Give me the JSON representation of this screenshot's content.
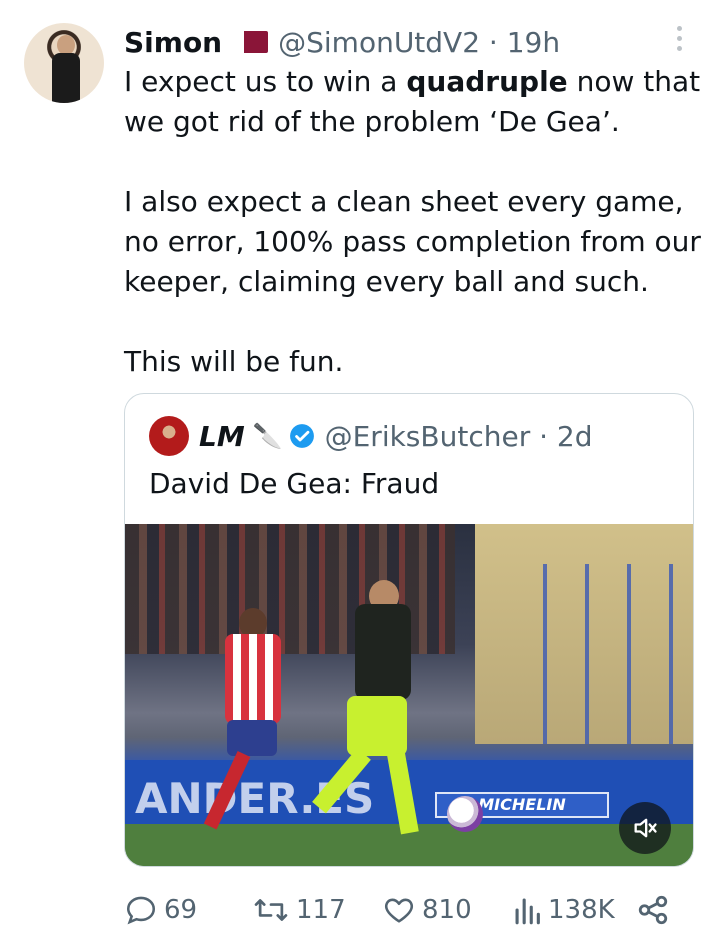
{
  "post": {
    "author": {
      "name": "Simon",
      "handle": "@SimonUtdV2",
      "time": "19h"
    },
    "text_lines": [
      "I expect us to win a ",
      "quadruple",
      " now that we got rid of the problem ‘De Gea’.\n\nI also expect a clean sheet every game, no error, 100% pass completion from our keeper, claiming every ball and such.\n\nThis will be fun."
    ]
  },
  "quoted": {
    "author": {
      "name": "LM",
      "handle": "@EriksButcher",
      "time": "2d"
    },
    "text": "David De Gea: Fraud",
    "media": {
      "board_text_left": "ANDER.ES",
      "board_text_right": "MICHELIN"
    }
  },
  "actions": {
    "replies": "69",
    "reposts": "117",
    "likes": "810",
    "views": "138K"
  },
  "colors": {
    "muted": "#536471",
    "verified": "#1d9bf0"
  },
  "icons": {
    "reply": "reply-icon",
    "repost": "repost-icon",
    "like": "heart-icon",
    "views": "views-chart-icon",
    "share": "share-icon",
    "more": "more-dots-icon",
    "mute": "mute-speaker-icon",
    "verified": "verified-badge-icon",
    "flag": "qatar-flag-icon",
    "knife": "knife-emoji-icon"
  }
}
